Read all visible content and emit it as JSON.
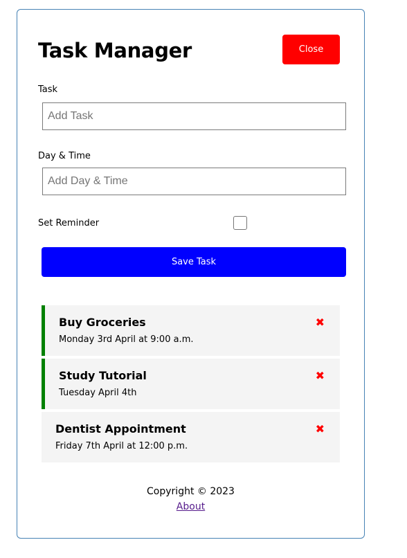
{
  "header": {
    "title": "Task Manager",
    "close_label": "Close"
  },
  "form": {
    "task_label": "Task",
    "task_placeholder": "Add Task",
    "day_label": "Day & Time",
    "day_placeholder": "Add Day & Time",
    "reminder_label": "Set Reminder",
    "reminder_checked": false,
    "save_label": "Save Task"
  },
  "tasks": [
    {
      "text": "Buy Groceries",
      "day": "Monday 3rd April at 9:00 a.m.",
      "reminder": true
    },
    {
      "text": "Study Tutorial",
      "day": "Tuesday April 4th",
      "reminder": true
    },
    {
      "text": "Dentist Appointment",
      "day": "Friday 7th April at 12:00 p.m.",
      "reminder": false
    }
  ],
  "footer": {
    "copyright": "Copyright © 2023",
    "about_label": "About"
  },
  "colors": {
    "close_button": "#ff0000",
    "save_button": "#0000ff",
    "reminder_border": "#008000",
    "delete_icon": "#ff0000",
    "container_border": "#4682b4"
  },
  "icons": {
    "delete": "times-icon"
  }
}
